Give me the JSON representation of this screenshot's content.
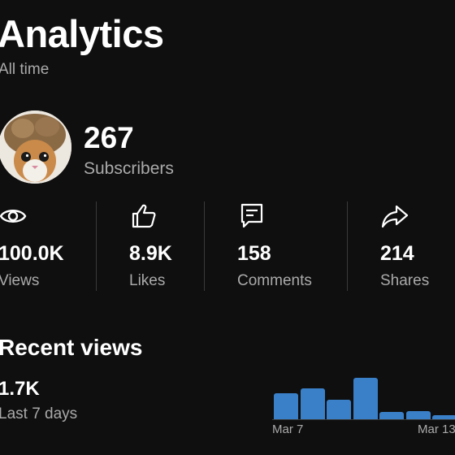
{
  "header": {
    "title": "Analytics",
    "subtitle": "All time"
  },
  "channel": {
    "subscriber_count": "267",
    "subscriber_label": "Subscribers"
  },
  "stats": [
    {
      "icon": "eye-icon",
      "value": "100.0K",
      "label": "Views"
    },
    {
      "icon": "thumbs-up-icon",
      "value": "8.9K",
      "label": "Likes"
    },
    {
      "icon": "comment-icon",
      "value": "158",
      "label": "Comments"
    },
    {
      "icon": "share-icon",
      "value": "214",
      "label": "Shares"
    }
  ],
  "recent": {
    "title": "Recent views",
    "value": "1.7K",
    "period_label": "Last 7 days"
  },
  "colors": {
    "background": "#0f0f0f",
    "bar": "#3a80c9",
    "muted_text": "#aaaaaa"
  },
  "chart_data": {
    "type": "bar",
    "x_tick_labels": [
      "Mar 7",
      "Mar 13"
    ],
    "values": [
      0.6,
      0.7,
      0.45,
      0.95,
      0.16,
      0.18,
      0.1
    ],
    "note_values": "relative heights, no y-axis shown",
    "ylim": [
      0,
      1
    ]
  }
}
